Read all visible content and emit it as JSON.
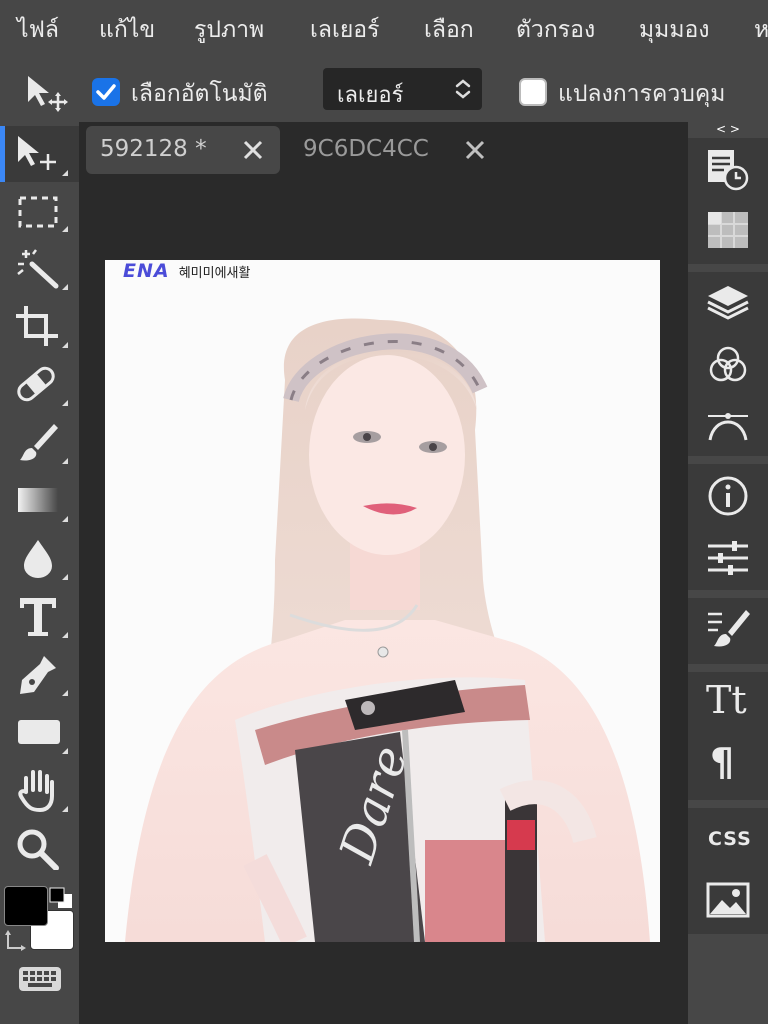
{
  "menubar": {
    "items": [
      "ไฟล์",
      "แก้ไข",
      "รูปภาพ",
      "เลเยอร์",
      "เลือก",
      "ตัวกรอง",
      "มุมมอง",
      "ห"
    ]
  },
  "options": {
    "auto_select_label": "เลือกอัตโนมัติ",
    "auto_select_checked": true,
    "layer_select_value": "เลเยอร์",
    "transform_controls_label": "แปลงการควบคุม",
    "transform_controls_checked": false
  },
  "tabs": [
    {
      "title": "592128 *",
      "active": true
    },
    {
      "title": "9C6DC4CC",
      "active": false
    }
  ],
  "canvas": {
    "watermark_logo_text": "ENA",
    "watermark_signature": "혜미미에새활"
  },
  "rightpanel": {
    "collapse_label": "< >",
    "text_tool_glyph": "Tt",
    "paragraph_glyph": "¶",
    "css_label": "CSS"
  },
  "colors": {
    "accent": "#3b87f5",
    "checkbox_on": "#1a73e8",
    "foreground": "#000000",
    "background": "#ffffff"
  }
}
